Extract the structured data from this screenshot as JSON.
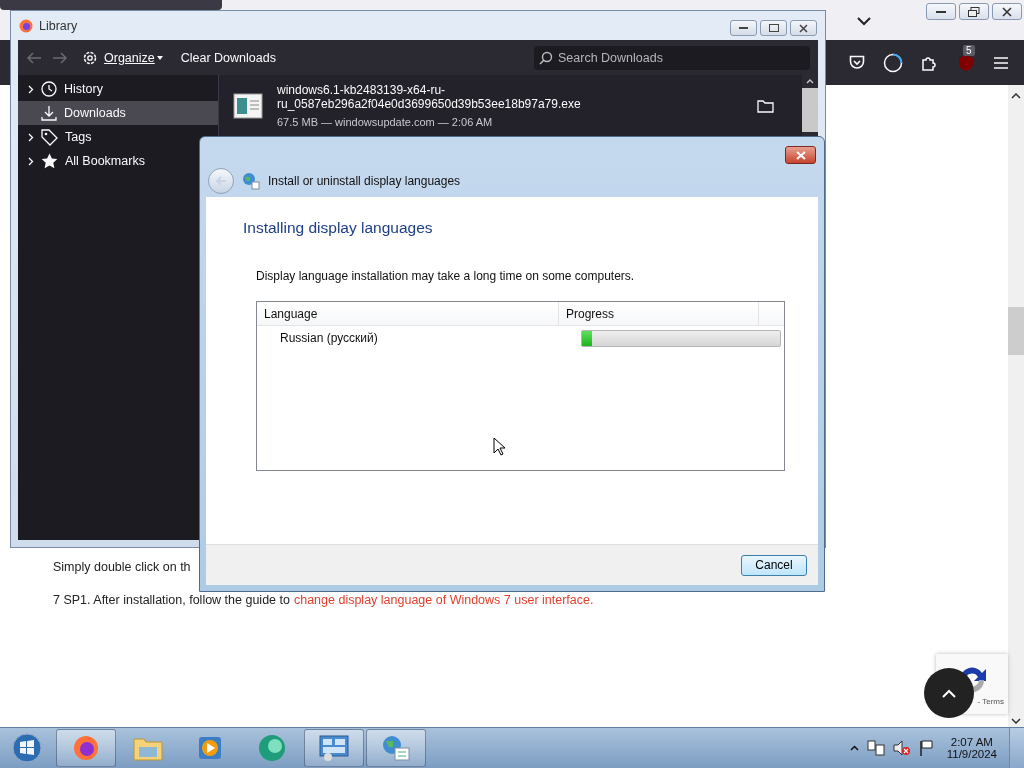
{
  "browser": {
    "badge": "5",
    "page": {
      "line_1": "Simply double click on th",
      "line_2": "7 SP1. After installation, follow the guide to",
      "link": "change display language of Windows 7 user interface.",
      "recaptcha": "- Terms"
    }
  },
  "library": {
    "title": "Library",
    "organize": "Organize",
    "clear": "Clear Downloads",
    "search_placeholder": "Search Downloads",
    "sidebar": [
      {
        "label": "History",
        "kind": "clock",
        "expandable": true,
        "selected": false
      },
      {
        "label": "Downloads",
        "kind": "download",
        "expandable": false,
        "selected": true
      },
      {
        "label": "Tags",
        "kind": "tag",
        "expandable": true,
        "selected": false
      },
      {
        "label": "All Bookmarks",
        "kind": "star",
        "expandable": true,
        "selected": false
      }
    ],
    "downloads": [
      {
        "name": "windows6.1-kb2483139-x64-ru-ru_0587eb296a2f04e0d3699650d39b53ee18b97a79.exe",
        "meta": "67.5 MB — windowsupdate.com — 2:06 AM"
      }
    ]
  },
  "dialog": {
    "title": "Install or uninstall display languages",
    "heading": "Installing display languages",
    "description": "Display language installation may take a long time on some computers.",
    "columns": [
      "Language",
      "Progress"
    ],
    "rows": [
      {
        "language": "Russian (русский)",
        "level": 0.05
      }
    ],
    "cancel": "Cancel"
  },
  "taskbar": {
    "time": "2:07 AM",
    "date": "11/9/2024"
  }
}
